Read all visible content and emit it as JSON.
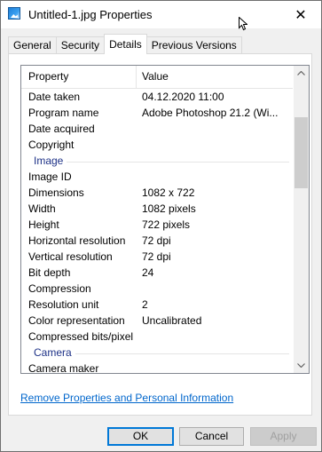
{
  "window": {
    "title": "Untitled-1.jpg Properties",
    "close_glyph": "✕"
  },
  "tabs": [
    {
      "label": "General"
    },
    {
      "label": "Security"
    },
    {
      "label": "Details"
    },
    {
      "label": "Previous Versions"
    }
  ],
  "active_tab": "Details",
  "list": {
    "col_property": "Property",
    "col_value": "Value",
    "rows": [
      {
        "k": "Date taken",
        "v": "04.12.2020 11:00"
      },
      {
        "k": "Program name",
        "v": "Adobe Photoshop 21.2 (Wi..."
      },
      {
        "k": "Date acquired",
        "v": ""
      },
      {
        "k": "Copyright",
        "v": ""
      },
      {
        "group": "Image"
      },
      {
        "k": "Image ID",
        "v": ""
      },
      {
        "k": "Dimensions",
        "v": "1082 x 722"
      },
      {
        "k": "Width",
        "v": "1082 pixels"
      },
      {
        "k": "Height",
        "v": "722 pixels"
      },
      {
        "k": "Horizontal resolution",
        "v": "72 dpi"
      },
      {
        "k": "Vertical resolution",
        "v": "72 dpi"
      },
      {
        "k": "Bit depth",
        "v": "24"
      },
      {
        "k": "Compression",
        "v": ""
      },
      {
        "k": "Resolution unit",
        "v": "2"
      },
      {
        "k": "Color representation",
        "v": "Uncalibrated"
      },
      {
        "k": "Compressed bits/pixel",
        "v": ""
      },
      {
        "group": "Camera"
      },
      {
        "k": "Camera maker",
        "v": ""
      }
    ]
  },
  "remove_link": "Remove Properties and Personal Information",
  "buttons": {
    "ok": "OK",
    "cancel": "Cancel",
    "apply": "Apply"
  },
  "icons": {
    "file": "image-file-icon",
    "close": "close-icon",
    "cursor": "mouse-cursor-icon"
  }
}
